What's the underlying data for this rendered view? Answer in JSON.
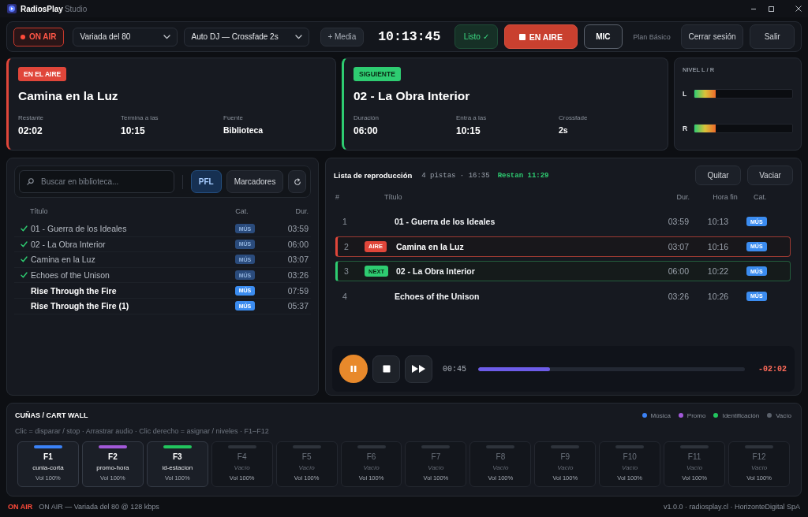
{
  "window": {
    "app_name": "RadiosPlay",
    "edition": "Studio"
  },
  "toolbar": {
    "on_air_indicator": "ON AIR",
    "station_select": "Variada del 80",
    "mode_select": "Auto DJ — Crossfade 2s",
    "media_button": "+ Media",
    "clock": "10:13:45",
    "ready_button": "Listo ✓",
    "broadcast_button": "EN AIRE",
    "mic_button": "MIC",
    "plan": "Plan Básico",
    "logout_button": "Cerrar sesión",
    "exit_button": "Salir"
  },
  "now_playing": {
    "badge": "EN EL AIRE",
    "title": "Camina en la Luz",
    "fields": [
      {
        "label": "Restante",
        "value": "02:02"
      },
      {
        "label": "Termina a las",
        "value": "10:15"
      },
      {
        "label": "Fuente",
        "value": "Biblioteca"
      }
    ]
  },
  "up_next": {
    "badge": "SIGUIENTE",
    "title": "02 - La Obra Interior",
    "fields": [
      {
        "label": "Duración",
        "value": "06:00"
      },
      {
        "label": "Entra a las",
        "value": "10:15"
      },
      {
        "label": "Crossfade",
        "value": "2s"
      }
    ]
  },
  "levels": {
    "title": "NIVEL L / R",
    "channels": [
      {
        "name": "L",
        "level": 0.22
      },
      {
        "name": "R",
        "level": 0.22
      }
    ]
  },
  "library": {
    "search": {
      "placeholder": "Buscar en biblioteca..."
    },
    "buttons": [
      {
        "label": "PFL",
        "selected": true
      },
      {
        "label": "Marcadores",
        "selected": false
      }
    ],
    "columns": [
      "Título",
      "Cat.",
      "Dur."
    ],
    "rows": [
      {
        "played": true,
        "title": "01 - Guerra de los Ideales",
        "category": "MÚS",
        "duration": "03:59"
      },
      {
        "played": true,
        "title": "02 - La Obra Interior",
        "category": "MÚS",
        "duration": "06:00"
      },
      {
        "played": true,
        "title": "Camina en la Luz",
        "category": "MÚS",
        "duration": "03:07"
      },
      {
        "played": true,
        "title": "Echoes of the Unison",
        "category": "MÚS",
        "duration": "03:26"
      },
      {
        "played": false,
        "title": "Rise Through the Fire",
        "category": "MÚS",
        "duration": "07:59"
      },
      {
        "played": false,
        "title": "Rise Through the Fire (1)",
        "category": "MÚS",
        "duration": "05:37"
      }
    ]
  },
  "playlist": {
    "title": "Lista de reproducción",
    "summary": "4 pistas · 16:35",
    "remaining": "Restan 11:29",
    "buttons": [
      "Quitar",
      "Vaciar"
    ],
    "columns": [
      "#",
      "Título",
      "Dur.",
      "Hora fin",
      "Cat."
    ],
    "rows": [
      {
        "number": "1",
        "kind": "queued",
        "title": "01 - Guerra de los Ideales",
        "duration": "03:59",
        "end_time": "10:13",
        "category": "MÚS"
      },
      {
        "number": "2",
        "kind": "airing",
        "badge": "AIRE",
        "title": "Camina en la Luz",
        "duration": "03:07",
        "end_time": "10:16",
        "category": "MÚS"
      },
      {
        "number": "3",
        "kind": "next",
        "badge": "NEXT",
        "title": "02 - La Obra Interior",
        "duration": "06:00",
        "end_time": "10:22",
        "category": "MÚS"
      },
      {
        "number": "4",
        "kind": "queued",
        "title": "Echoes of the Unison",
        "duration": "03:26",
        "end_time": "10:26",
        "category": "MÚS"
      }
    ]
  },
  "player": {
    "playing": true,
    "elapsed": "00:45",
    "level": 0.27,
    "remaining": "-02:02"
  },
  "cart_wall": {
    "title": "CUÑAS / CART WALL",
    "legend": [
      {
        "label": "Música",
        "color": "#3b82f6"
      },
      {
        "label": "Promo",
        "color": "#a259d9"
      },
      {
        "label": "Identificación",
        "color": "#22c55e"
      },
      {
        "label": "Vacío",
        "color": "#5b616b"
      }
    ],
    "hint": "Clic = disparar / stop · Arrastrar audio · Clic derecho = asignar / niveles · F1–F12",
    "carts": [
      {
        "key": "F1",
        "name": "cunia-corta",
        "volume": "Vol 100%",
        "color": "#3b82f6",
        "empty": false
      },
      {
        "key": "F2",
        "name": "promo-hora",
        "volume": "Vol 100%",
        "color": "#a259d9",
        "empty": false
      },
      {
        "key": "F3",
        "name": "id-estacion",
        "volume": "Vol 100%",
        "color": "#22c55e",
        "empty": false
      },
      {
        "key": "F4",
        "name": "Vacío",
        "volume": "Vol 100%",
        "color": "#2e333b",
        "empty": true
      },
      {
        "key": "F5",
        "name": "Vacío",
        "volume": "Vol 100%",
        "color": "#2e333b",
        "empty": true
      },
      {
        "key": "F6",
        "name": "Vacío",
        "volume": "Vol 100%",
        "color": "#2e333b",
        "empty": true
      },
      {
        "key": "F7",
        "name": "Vacío",
        "volume": "Vol 100%",
        "color": "#2e333b",
        "empty": true
      },
      {
        "key": "F8",
        "name": "Vacío",
        "volume": "Vol 100%",
        "color": "#2e333b",
        "empty": true
      },
      {
        "key": "F9",
        "name": "Vacío",
        "volume": "Vol 100%",
        "color": "#2e333b",
        "empty": true
      },
      {
        "key": "F10",
        "name": "Vacío",
        "volume": "Vol 100%",
        "color": "#2e333b",
        "empty": true
      },
      {
        "key": "F11",
        "name": "Vacío",
        "volume": "Vol 100%",
        "color": "#2e333b",
        "empty": true
      },
      {
        "key": "F12",
        "name": "Vacío",
        "volume": "Vol 100%",
        "color": "#2e333b",
        "empty": true
      }
    ]
  },
  "status_bar": {
    "badge": "ON AIR",
    "text": "ON AIR — Variada del 80 @ 128 kbps",
    "footer": "v1.0.0 · radiosplay.cl · HorizonteDigital SpA"
  }
}
